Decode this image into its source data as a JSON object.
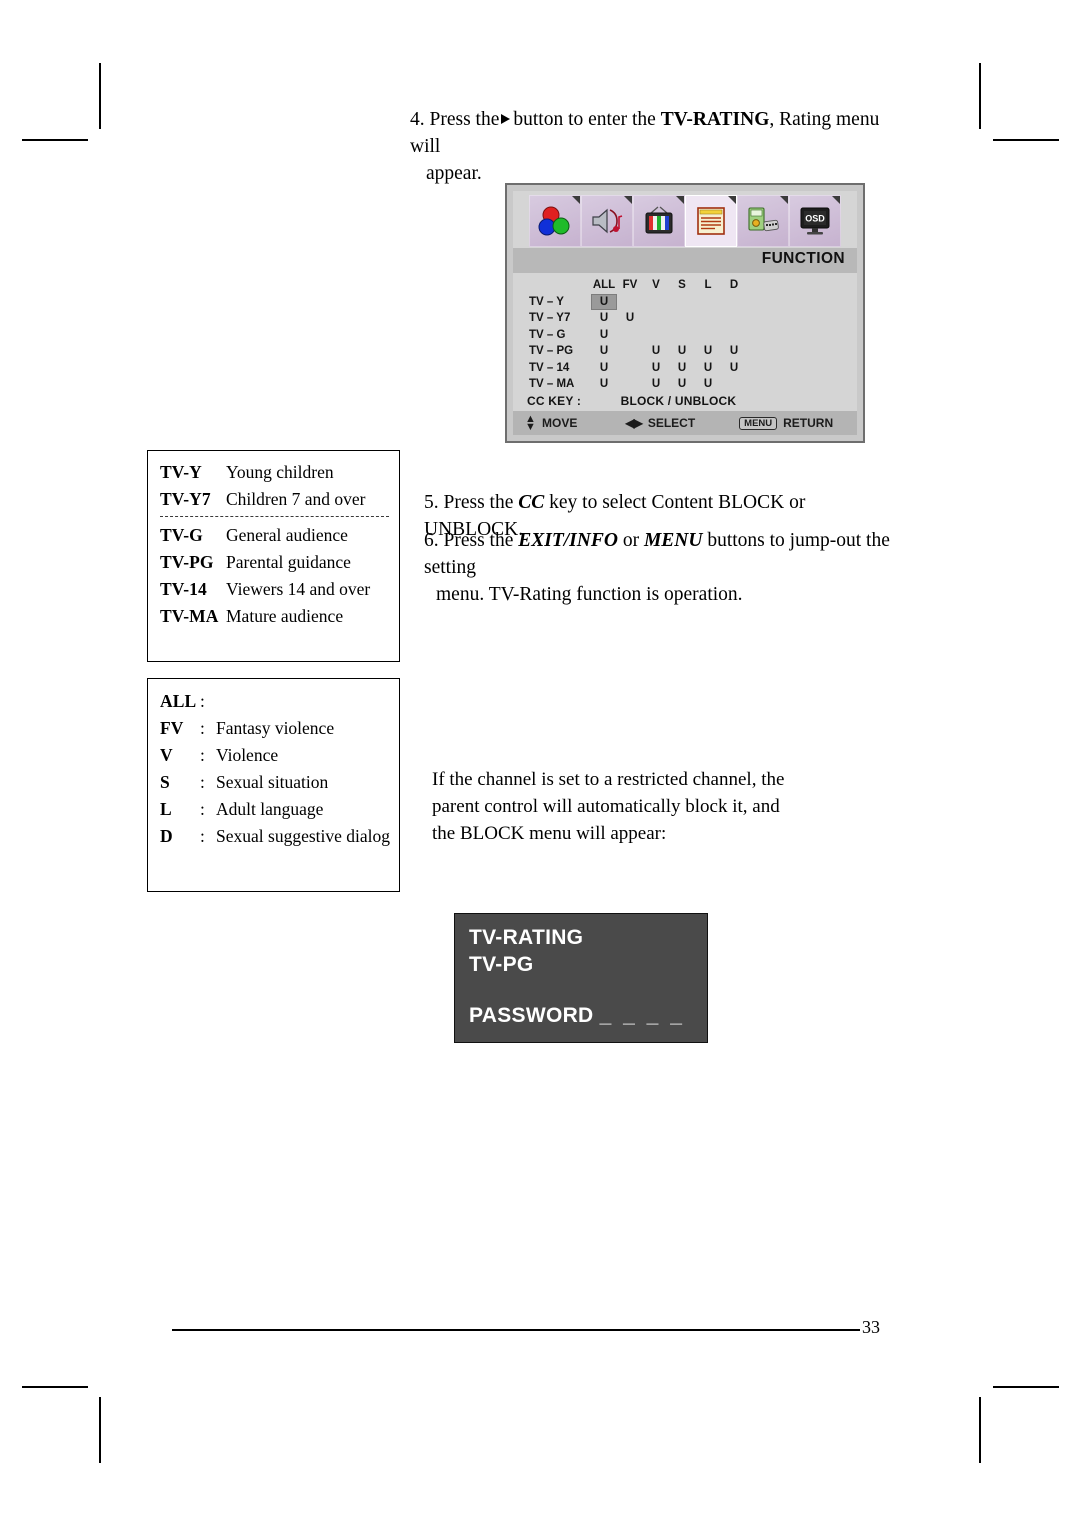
{
  "page": {
    "number": "33"
  },
  "steps": {
    "step4": {
      "num": "4.",
      "part1": "Press the",
      "icon": "right-triangle",
      "part2": "button to enter the",
      "emphasis": "TV-RATING",
      "part3": ", Rating menu will",
      "continuation": "appear."
    },
    "step5": {
      "num": "5.",
      "part1": "Press the",
      "emphasis": "CC",
      "part2": "key to select Content BLOCK or UNBLOCK."
    },
    "step6": {
      "num": "6.",
      "part1": "Press the",
      "emphasis1": "EXIT/INFO",
      "part2": "or",
      "emphasis2": "MENU",
      "part3": "buttons to jump-out the setting",
      "continuation": "menu. TV-Rating function is operation."
    }
  },
  "osd_menu": {
    "icons": [
      {
        "name": "picture-icon",
        "label": "PICTURE"
      },
      {
        "name": "audio-icon",
        "label": "AUDIO"
      },
      {
        "name": "channel-icon",
        "label": "CHANNEL"
      },
      {
        "name": "function-icon",
        "label": "FUNCTION"
      },
      {
        "name": "setup-icon",
        "label": "SETUP"
      },
      {
        "name": "osd-icon",
        "label": "OSD"
      }
    ],
    "selected_icon_index": 3,
    "title": "FUNCTION",
    "columns": [
      "ALL",
      "FV",
      "V",
      "S",
      "L",
      "D"
    ],
    "rows": [
      {
        "label": "TV – Y",
        "values": [
          "U",
          "",
          "",
          "",
          "",
          ""
        ],
        "highlight": 0
      },
      {
        "label": "TV – Y7",
        "values": [
          "U",
          "U",
          "",
          "",
          "",
          ""
        ],
        "highlight": -1
      },
      {
        "label": "TV – G",
        "values": [
          "U",
          "",
          "",
          "",
          "",
          ""
        ],
        "highlight": -1
      },
      {
        "label": "TV – PG",
        "values": [
          "U",
          "",
          "U",
          "U",
          "U",
          "U"
        ],
        "highlight": -1
      },
      {
        "label": "TV – 14",
        "values": [
          "U",
          "",
          "U",
          "U",
          "U",
          "U"
        ],
        "highlight": -1
      },
      {
        "label": "TV – MA",
        "values": [
          "U",
          "",
          "U",
          "U",
          "U",
          ""
        ],
        "highlight": -1
      }
    ],
    "cc_key_label": "CC KEY :",
    "cc_key_value": "BLOCK / UNBLOCK",
    "buttons": [
      {
        "icon": "up-down-arrow-icon",
        "label": "MOVE"
      },
      {
        "icon": "left-right-arrow-icon",
        "label": "SELECT"
      },
      {
        "icon": "menu-key-icon",
        "key": "MENU",
        "label": "RETURN"
      }
    ]
  },
  "ratings_legend": [
    {
      "key": "TV-Y",
      "value": "Young children"
    },
    {
      "key": "TV-Y7",
      "value": "Children 7 and over"
    },
    {
      "key": "TV-G",
      "value": "General audience"
    },
    {
      "key": "TV-PG",
      "value": "Parental guidance"
    },
    {
      "key": "TV-14",
      "value": "Viewers 14 and over"
    },
    {
      "key": "TV-MA",
      "value": "Mature audience"
    }
  ],
  "content_legend": [
    {
      "key": "ALL",
      "colon": ":",
      "value": ""
    },
    {
      "key": "FV",
      "colon": ":",
      "value": "Fantasy violence"
    },
    {
      "key": "V",
      "colon": ":",
      "value": "Violence"
    },
    {
      "key": "S",
      "colon": ":",
      "value": "Sexual situation"
    },
    {
      "key": "L",
      "colon": ":",
      "value": "Adult language"
    },
    {
      "key": "D",
      "colon": ":",
      "value": "Sexual suggestive dialog"
    }
  ],
  "restricted_note": {
    "line1": "If the channel is set to a restricted channel, the",
    "line2": "parent control will automatically block it, and",
    "line3": "the BLOCK menu will appear:"
  },
  "password_osd": {
    "line1": "TV-RATING",
    "line2": "TV-PG",
    "line3_label": "PASSWORD",
    "line3_dashes": "_ _ _ _",
    "background": "#4a4a4a",
    "text_color": "#ffffff"
  }
}
